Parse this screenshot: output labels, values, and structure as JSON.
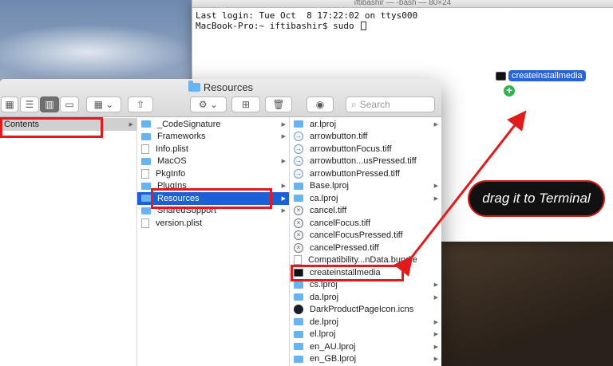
{
  "terminal": {
    "title": "iftibashir — -bash — 80×24",
    "line1": "Last login: Tue Oct  8 17:22:02 on ttys000",
    "line2": "MacBook-Pro:~ iftibashir$ sudo "
  },
  "drag": {
    "label": "createinstallmedia"
  },
  "finder": {
    "title": "Resources",
    "search_placeholder": "Search",
    "col1": [
      {
        "label": "Contents"
      }
    ],
    "col2": [
      {
        "label": "_CodeSignature",
        "type": "folder"
      },
      {
        "label": "Frameworks",
        "type": "folder"
      },
      {
        "label": "Info.plist",
        "type": "file"
      },
      {
        "label": "MacOS",
        "type": "folder"
      },
      {
        "label": "PkgInfo",
        "type": "file"
      },
      {
        "label": "PlugIns",
        "type": "folder"
      },
      {
        "label": "Resources",
        "type": "folder"
      },
      {
        "label": "SharedSupport",
        "type": "folder"
      },
      {
        "label": "version.plist",
        "type": "file"
      }
    ],
    "col3": [
      {
        "label": "ar.lproj",
        "type": "folder"
      },
      {
        "label": "arrowbutton.tiff",
        "type": "circle"
      },
      {
        "label": "arrowbuttonFocus.tiff",
        "type": "circle"
      },
      {
        "label": "arrowbutton...usPressed.tiff",
        "type": "circle"
      },
      {
        "label": "arrowbuttonPressed.tiff",
        "type": "circle"
      },
      {
        "label": "Base.lproj",
        "type": "folder"
      },
      {
        "label": "ca.lproj",
        "type": "folder"
      },
      {
        "label": "cancel.tiff",
        "type": "x"
      },
      {
        "label": "cancelFocus.tiff",
        "type": "x"
      },
      {
        "label": "cancelFocusPressed.tiff",
        "type": "x"
      },
      {
        "label": "cancelPressed.tiff",
        "type": "x"
      },
      {
        "label": "Compatibility...nData.bundle",
        "type": "file"
      },
      {
        "label": "createinstallmedia",
        "type": "exec"
      },
      {
        "label": "cs.lproj",
        "type": "folder"
      },
      {
        "label": "da.lproj",
        "type": "folder"
      },
      {
        "label": "DarkProductPageIcon.icns",
        "type": "dark"
      },
      {
        "label": "de.lproj",
        "type": "folder"
      },
      {
        "label": "el.lproj",
        "type": "folder"
      },
      {
        "label": "en_AU.lproj",
        "type": "folder"
      },
      {
        "label": "en_GB.lproj",
        "type": "folder"
      }
    ]
  },
  "callout": {
    "text": "drag it to Terminal"
  },
  "colors": {
    "highlight": "#e11b1b",
    "selection": "#1a61d8"
  }
}
